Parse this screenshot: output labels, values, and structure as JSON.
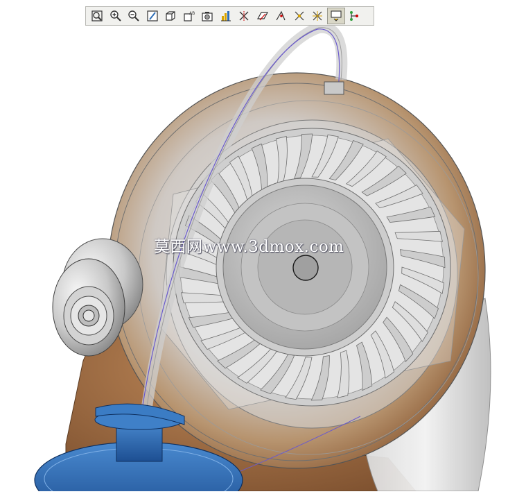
{
  "toolbar": {
    "buttons": [
      {
        "icon": "zoom-fit-icon"
      },
      {
        "icon": "zoom-in-icon"
      },
      {
        "icon": "zoom-out-icon"
      },
      {
        "icon": "repaint-icon"
      },
      {
        "icon": "view-orientation-icon"
      },
      {
        "icon": "saved-views-icon"
      },
      {
        "icon": "display-style-icon"
      },
      {
        "icon": "datum-display-icon"
      },
      {
        "icon": "axis-display-icon"
      },
      {
        "icon": "plane-display-icon"
      },
      {
        "icon": "point-display-icon"
      },
      {
        "icon": "csys-display-icon"
      },
      {
        "icon": "annotation-display-icon"
      },
      {
        "icon": "spin-center-icon",
        "active": true
      },
      {
        "icon": "network-icon"
      }
    ]
  },
  "watermark": "莫西网www.3dmox.com",
  "colors": {
    "housing_bronze": "#9a6a45",
    "translucent_gray": "#c8c8c8",
    "flange_blue": "#2f6fb8",
    "curve_purple": "#6a5acd",
    "background": "#ffffff"
  }
}
